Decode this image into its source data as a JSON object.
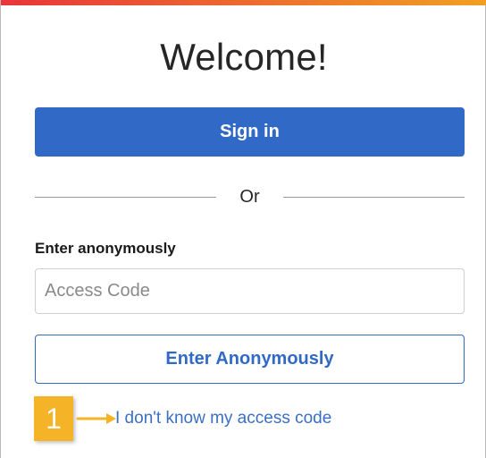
{
  "welcome": {
    "title": "Welcome!"
  },
  "signin": {
    "label": "Sign in"
  },
  "divider": {
    "text": "Or"
  },
  "anonymous": {
    "section_label": "Enter anonymously",
    "access_code_placeholder": "Access Code",
    "access_code_value": "",
    "button_label": "Enter Anonymously"
  },
  "help": {
    "step_number": "1",
    "forgot_link": "I don't know my access code"
  },
  "icons": {
    "step_arrow": "arrow-right-icon"
  },
  "colors": {
    "primary": "#3169c6",
    "primary_text": "#ffffff",
    "link": "#3a6fc4",
    "callout": "#f5b427",
    "stripe_start": "#e8353a",
    "stripe_end": "#f0a023"
  }
}
